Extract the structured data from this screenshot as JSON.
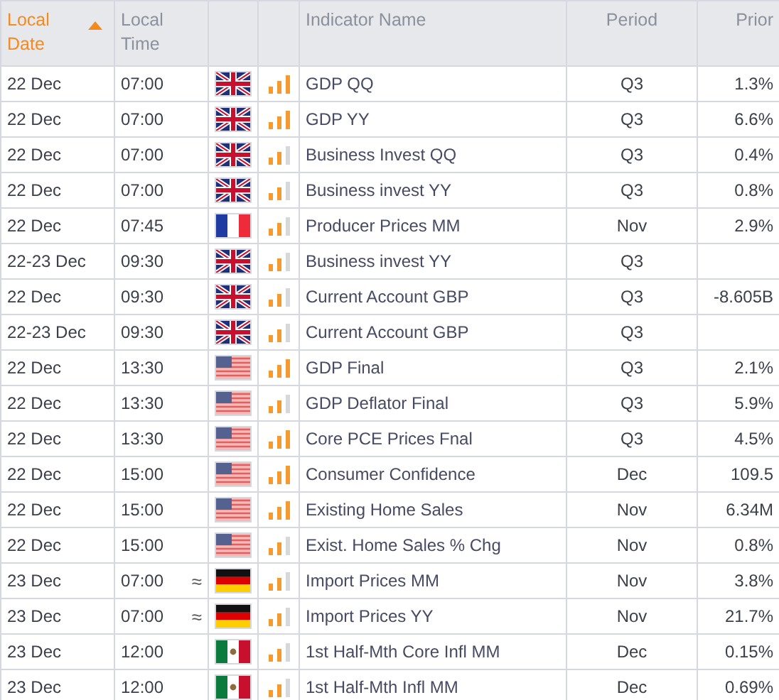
{
  "table": {
    "columns": [
      {
        "label": "Local Date",
        "selected": true
      },
      {
        "label": "Local Time",
        "selected": false
      },
      {
        "label": "Indicator Name",
        "selected": false
      },
      {
        "label": "Period",
        "selected": false
      },
      {
        "label": "Prior",
        "selected": false
      }
    ],
    "rows": [
      {
        "date": "22 Dec",
        "time": "07:00",
        "kind": "uk",
        "level": 1,
        "name": "GDP QQ",
        "period": "Q3",
        "prior": "1.3%"
      },
      {
        "date": "22 Dec",
        "time": "07:00",
        "kind": "uk",
        "level": 1,
        "name": "GDP YY",
        "period": "Q3",
        "prior": "6.6%"
      },
      {
        "date": "22 Dec",
        "time": "07:00",
        "kind": "uk",
        "level": 0.67,
        "name": "Business Invest QQ",
        "period": "Q3",
        "prior": "0.4%"
      },
      {
        "date": "22 Dec",
        "time": "07:00",
        "kind": "uk",
        "level": 0.67,
        "name": "Business invest YY",
        "period": "Q3",
        "prior": "0.8%"
      },
      {
        "date": "22 Dec",
        "time": "07:45",
        "kind": "fr",
        "level": 0.67,
        "name": "Producer Prices MM",
        "period": "Nov",
        "prior": "2.9%"
      },
      {
        "date": "22-23 Dec",
        "time": "09:30",
        "kind": "uk",
        "level": 0.67,
        "name": "Business invest YY",
        "period": "Q3"
      },
      {
        "date": "22 Dec",
        "time": "09:30",
        "kind": "uk",
        "level": 0.67,
        "name": "Current Account GBP",
        "period": "Q3",
        "prior": "-8.605B"
      },
      {
        "date": "22-23 Dec",
        "time": "09:30",
        "kind": "uk",
        "level": 0.67,
        "name": "Current Account GBP",
        "period": "Q3"
      },
      {
        "date": "22 Dec",
        "time": "13:30",
        "kind": "us",
        "level": 1,
        "name": "GDP Final",
        "period": "Q3",
        "prior": "2.1%"
      },
      {
        "date": "22 Dec",
        "time": "13:30",
        "kind": "us",
        "level": 0.67,
        "name": "GDP Deflator Final",
        "period": "Q3",
        "prior": "5.9%"
      },
      {
        "date": "22 Dec",
        "time": "13:30",
        "kind": "us",
        "level": 1,
        "name": "Core PCE Prices Fnal",
        "period": "Q3",
        "prior": "4.5%"
      },
      {
        "date": "22 Dec",
        "time": "15:00",
        "kind": "us",
        "level": 1,
        "name": "Consumer Confidence",
        "period": "Dec",
        "prior": "109.5"
      },
      {
        "date": "22 Dec",
        "time": "15:00",
        "kind": "us",
        "level": 1,
        "name": "Existing Home Sales",
        "period": "Nov",
        "prior": "6.34M"
      },
      {
        "date": "22 Dec",
        "time": "15:00",
        "kind": "us",
        "level": 0.67,
        "name": "Exist. Home Sales % Chg",
        "period": "Nov",
        "prior": "0.8%"
      },
      {
        "date": "23 Dec",
        "time": "07:00",
        "approx": "≈",
        "kind": "de",
        "level": 0.67,
        "name": "Import Prices MM",
        "period": "Nov",
        "prior": "3.8%"
      },
      {
        "date": "23 Dec",
        "time": "07:00",
        "approx": "≈",
        "kind": "de",
        "level": 0.67,
        "name": "Import Prices YY",
        "period": "Nov",
        "prior": "21.7%"
      },
      {
        "date": "23 Dec",
        "time": "12:00",
        "kind": "mx",
        "level": 0.67,
        "name": "1st Half-Mth Core Infl MM",
        "period": "Dec",
        "prior": "0.15%"
      },
      {
        "date": "23 Dec",
        "time": "12:00",
        "kind": "mx",
        "level": 0.67,
        "name": "1st Half-Mth Infl MM",
        "period": "Dec",
        "prior": "0.69%"
      }
    ]
  }
}
